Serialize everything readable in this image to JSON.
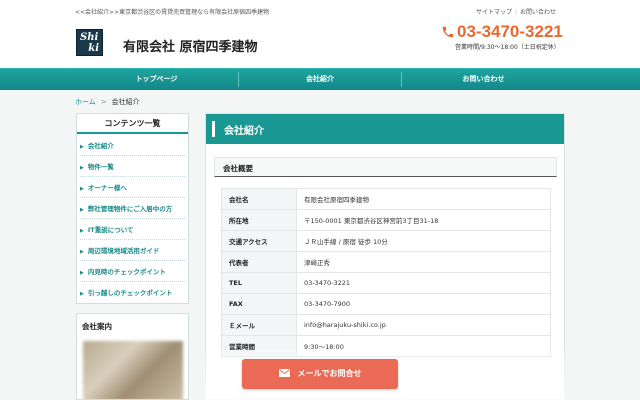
{
  "header": {
    "tagline": "<<会社紹介>>東京都渋谷区の賃貸売買管理なら有限会社原宿四季建物",
    "logo_line1": "Shi",
    "logo_line2": "ki",
    "company_name": "有限会社 原宿四季建物",
    "top_links": [
      "サイトマップ",
      "お問い合わせ"
    ],
    "phone": "03-3470-3221",
    "hours": "営業時間/9:30～18:00（土日祝定休）"
  },
  "nav": {
    "items": [
      "トップページ",
      "会社紹介",
      "お問い合わせ"
    ]
  },
  "breadcrumb": {
    "home": "ホーム",
    "separator": ">",
    "current": "会社紹介"
  },
  "sidebar": {
    "title": "コンテンツ一覧",
    "items": [
      "会社紹介",
      "物件一覧",
      "オーナー様へ",
      "弊社管理物件にご入居中の方",
      "IT重説について",
      "周辺環境地域活用ガイド",
      "内見時のチェックポイント",
      "引っ越しのチェックポイント"
    ]
  },
  "info_box": {
    "title": "会社案内"
  },
  "main": {
    "section_title": "会社紹介",
    "subsection_title": "会社概要",
    "rows": [
      {
        "key": "会社名",
        "value": "有限会社原宿四季建物"
      },
      {
        "key": "所在地",
        "value": "〒150-0001 東京都渋谷区神宮前3丁目31-18"
      },
      {
        "key": "交通アクセス",
        "value": "ＪＲ山手線 / 原宿 徒歩 10分"
      },
      {
        "key": "代表者",
        "value": "津﨑正秀"
      },
      {
        "key": "TEL",
        "value": "03-3470-3221"
      },
      {
        "key": "FAX",
        "value": "03-3470-7900"
      },
      {
        "key": "Ｅメール",
        "value": "info@harajuku-shiki.co.jp"
      },
      {
        "key": "営業時間",
        "value": "9:30～18:00"
      }
    ]
  },
  "contact_button": {
    "label": "メールでお問合せ"
  },
  "colors": {
    "brand_teal": "#1a9893",
    "phone_orange": "#e8692f",
    "button_coral": "#ea6a56"
  }
}
